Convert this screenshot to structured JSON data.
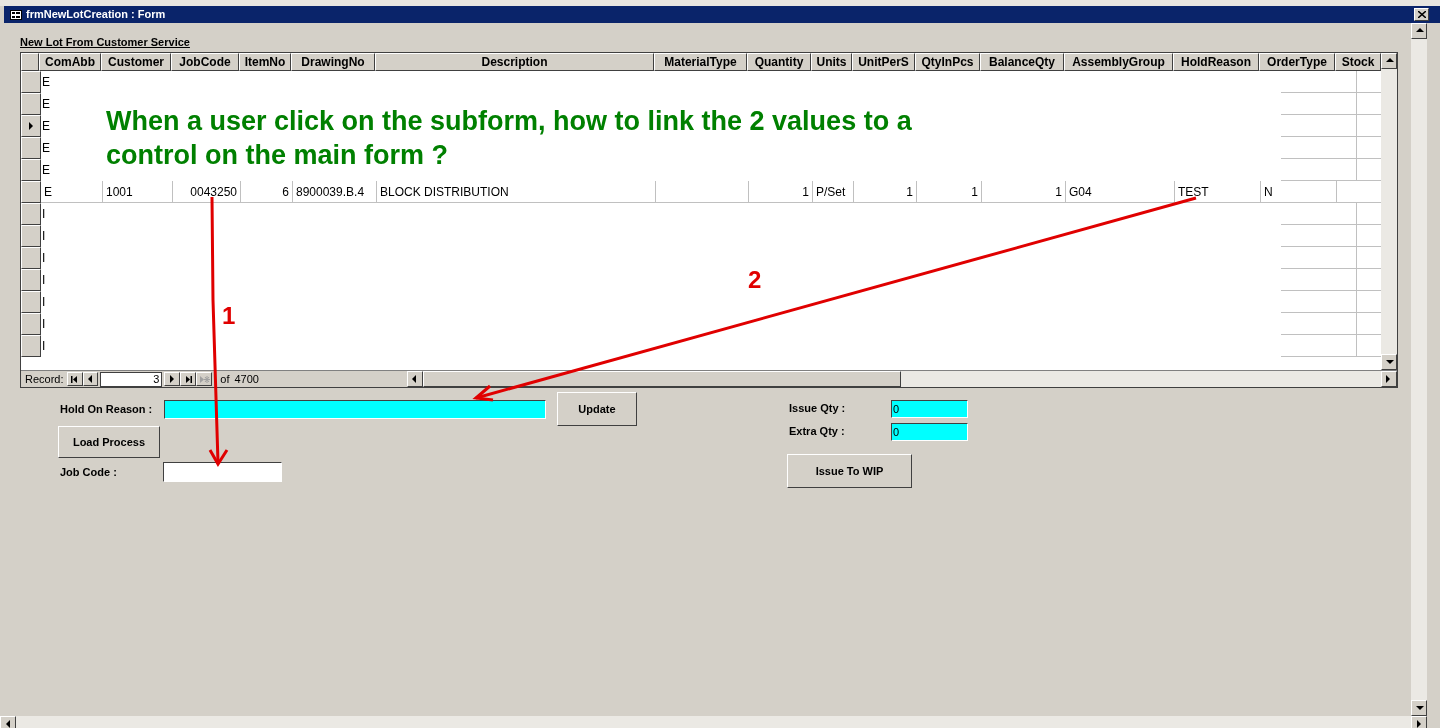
{
  "window": {
    "title": "frmNewLotCreation : Form"
  },
  "subform": {
    "label": "New Lot From Customer Service",
    "columns": [
      "ComAbb",
      "Customer",
      "JobCode",
      "ItemNo",
      "DrawingNo",
      "Description",
      "MaterialType",
      "Quantity",
      "Units",
      "UnitPerS",
      "QtyInPcs",
      "BalanceQty",
      "AssemblyGroup",
      "HoldReason",
      "OrderType",
      "Stock"
    ],
    "rows": [
      {
        "values": [
          "E"
        ],
        "selected": false
      },
      {
        "values": [
          "E"
        ],
        "selected": false
      },
      {
        "values": [
          "E"
        ],
        "selected": true
      },
      {
        "values": [
          "E"
        ],
        "selected": false
      },
      {
        "values": [
          "E"
        ],
        "selected": false
      },
      {
        "values": {
          "com_abb": "E",
          "customer": "1001",
          "job_code": "0043250",
          "item_no": "6",
          "drawing_no": "8900039.B.4",
          "description": "BLOCK DISTRIBUTION",
          "quantity": "1",
          "units": "P/Set",
          "unit_per_s": "1",
          "qty_in_pcs": "1",
          "balance_qty": "1",
          "assembly_group": "G04",
          "hold_reason": "TEST",
          "order_type": "N"
        },
        "selected": false
      },
      {
        "values": [
          "I"
        ],
        "selected": false
      },
      {
        "values": [
          "I"
        ],
        "selected": false
      },
      {
        "values": [
          "I"
        ],
        "selected": false
      },
      {
        "values": [
          "I"
        ],
        "selected": false
      },
      {
        "values": [
          "I"
        ],
        "selected": false
      },
      {
        "values": [
          "I"
        ],
        "selected": false
      },
      {
        "values": [
          "I"
        ],
        "selected": false
      }
    ]
  },
  "navigation": {
    "label": "Record:",
    "current": "3",
    "of_label": "of",
    "total": "4700"
  },
  "form": {
    "hold_reason": {
      "label": "Hold On Reason :"
    },
    "update_button": "Update",
    "load_process_button": "Load Process",
    "job_code": {
      "label": "Job Code :"
    },
    "issue_qty": {
      "label": "Issue Qty :",
      "value": "0"
    },
    "extra_qty": {
      "label": "Extra Qty :",
      "value": "0"
    },
    "issue_button": "Issue To WIP"
  },
  "annotation": {
    "lines": [
      "When a user click on the subform, how to link the 2 values to a",
      "control on the main form ?"
    ],
    "markers": [
      "1",
      "2"
    ]
  }
}
